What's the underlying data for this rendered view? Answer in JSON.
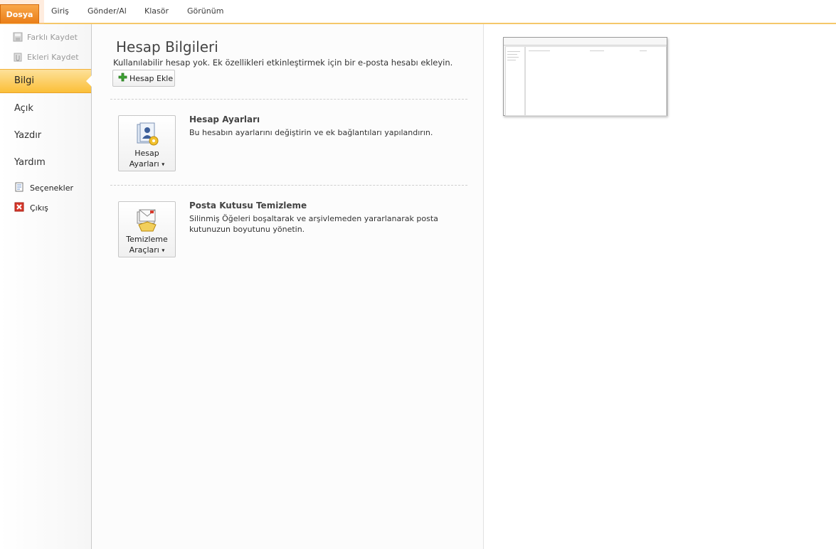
{
  "tabs": {
    "file": "Dosya",
    "items": [
      "Giriş",
      "Gönder/Al",
      "Klasör",
      "Görünüm"
    ]
  },
  "leftnav": {
    "save_as": "Farklı Kaydet",
    "save_attachments": "Ekleri Kaydet",
    "info": "Bilgi",
    "open": "Açık",
    "print": "Yazdır",
    "help": "Yardım",
    "options": "Seçenekler",
    "exit": "Çıkış"
  },
  "main": {
    "title": "Hesap Bilgileri",
    "subtitle": "Kullanılabilir hesap yok. Ek özellikleri etkinleştirmek için bir e-posta hesabı ekleyin.",
    "add_account": "Hesap Ekle",
    "account_settings": {
      "button_line1": "Hesap",
      "button_line2": "Ayarları",
      "title": "Hesap Ayarları",
      "desc": "Bu hesabın ayarlarını değiştirin ve ek bağlantıları yapılandırın."
    },
    "cleanup": {
      "button_line1": "Temizleme",
      "button_line2": "Araçları",
      "title": "Posta Kutusu Temizleme",
      "desc": "Silinmiş Öğeleri boşaltarak ve arşivlemeden yararlanarak posta kutunuzun boyutunu yönetin."
    }
  },
  "colors": {
    "accent": "#f5c86a",
    "file_tab": "#ea7e17",
    "active_nav": "#fbbf38"
  }
}
